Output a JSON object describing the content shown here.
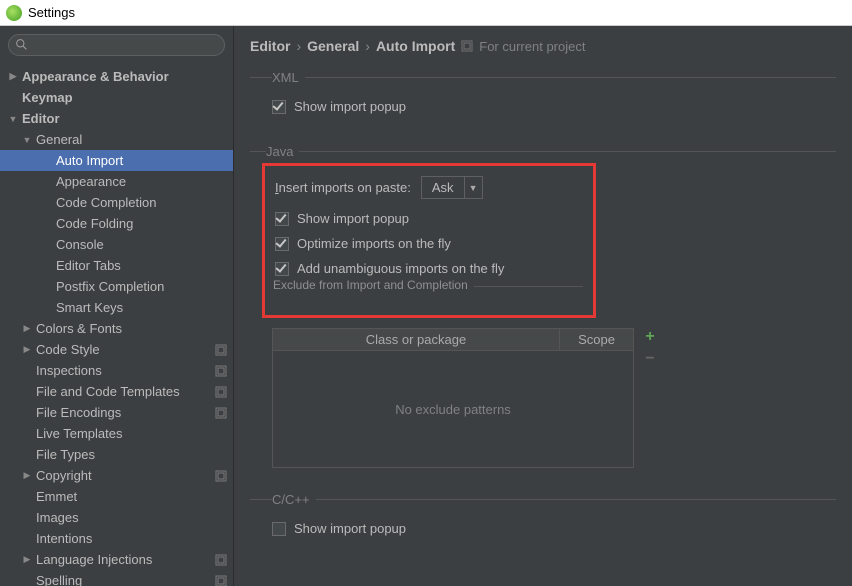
{
  "window": {
    "title": "Settings"
  },
  "search": {
    "placeholder": ""
  },
  "sidebar": {
    "items": [
      {
        "label": "Appearance & Behavior",
        "indent": 8,
        "arrow": "right",
        "bold": true
      },
      {
        "label": "Keymap",
        "indent": 8,
        "arrow": "none",
        "bold": true
      },
      {
        "label": "Editor",
        "indent": 8,
        "arrow": "down",
        "bold": true
      },
      {
        "label": "General",
        "indent": 22,
        "arrow": "down"
      },
      {
        "label": "Auto Import",
        "indent": 42,
        "arrow": "none",
        "selected": true
      },
      {
        "label": "Appearance",
        "indent": 42,
        "arrow": "none"
      },
      {
        "label": "Code Completion",
        "indent": 42,
        "arrow": "none"
      },
      {
        "label": "Code Folding",
        "indent": 42,
        "arrow": "none"
      },
      {
        "label": "Console",
        "indent": 42,
        "arrow": "none"
      },
      {
        "label": "Editor Tabs",
        "indent": 42,
        "arrow": "none"
      },
      {
        "label": "Postfix Completion",
        "indent": 42,
        "arrow": "none"
      },
      {
        "label": "Smart Keys",
        "indent": 42,
        "arrow": "none"
      },
      {
        "label": "Colors & Fonts",
        "indent": 22,
        "arrow": "right"
      },
      {
        "label": "Code Style",
        "indent": 22,
        "arrow": "right",
        "badge": true
      },
      {
        "label": "Inspections",
        "indent": 22,
        "arrow": "none",
        "badge": true
      },
      {
        "label": "File and Code Templates",
        "indent": 22,
        "arrow": "none",
        "badge": true
      },
      {
        "label": "File Encodings",
        "indent": 22,
        "arrow": "none",
        "badge": true
      },
      {
        "label": "Live Templates",
        "indent": 22,
        "arrow": "none"
      },
      {
        "label": "File Types",
        "indent": 22,
        "arrow": "none"
      },
      {
        "label": "Copyright",
        "indent": 22,
        "arrow": "right",
        "badge": true
      },
      {
        "label": "Emmet",
        "indent": 22,
        "arrow": "none"
      },
      {
        "label": "Images",
        "indent": 22,
        "arrow": "none"
      },
      {
        "label": "Intentions",
        "indent": 22,
        "arrow": "none"
      },
      {
        "label": "Language Injections",
        "indent": 22,
        "arrow": "right",
        "badge": true
      },
      {
        "label": "Spelling",
        "indent": 22,
        "arrow": "none",
        "badge": true
      }
    ]
  },
  "breadcrumb": {
    "a": "Editor",
    "b": "General",
    "c": "Auto Import",
    "project_label": "For current project"
  },
  "xml": {
    "legend": "XML",
    "show_import_popup": "Show import popup",
    "show_import_popup_checked": true
  },
  "java": {
    "legend": "Java",
    "insert_label_pre": "I",
    "insert_label_rest": "nsert imports on paste:",
    "insert_value": "Ask",
    "show_import_popup": "Show import popup",
    "optimize": "Optimize imports on the fly",
    "unambiguous": "Add unambiguous imports on the fly",
    "exclude_legend": "Exclude from Import and Completion",
    "col_class": "Class or package",
    "col_scope": "Scope",
    "empty": "No exclude patterns"
  },
  "cpp": {
    "legend": "C/C++",
    "show_import_popup": "Show import popup",
    "show_import_popup_checked": false
  }
}
